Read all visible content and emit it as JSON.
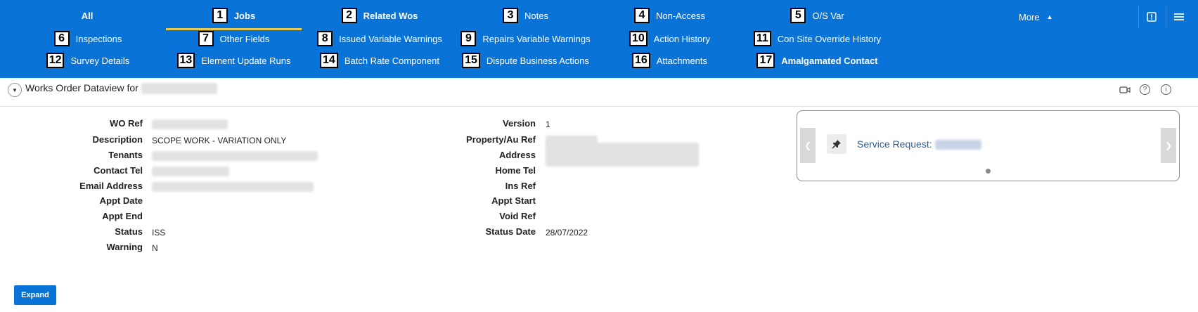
{
  "nav": {
    "tabs": [
      {
        "num": "",
        "label": "All"
      },
      {
        "num": "1",
        "label": "Jobs"
      },
      {
        "num": "2",
        "label": "Related Wos"
      },
      {
        "num": "3",
        "label": "Notes"
      },
      {
        "num": "4",
        "label": "Non-Access"
      },
      {
        "num": "5",
        "label": "O/S Var"
      },
      {
        "num": "6",
        "label": "Inspections"
      },
      {
        "num": "7",
        "label": "Other Fields"
      },
      {
        "num": "8",
        "label": "Issued Variable Warnings"
      },
      {
        "num": "9",
        "label": "Repairs Variable Warnings"
      },
      {
        "num": "10",
        "label": "Action History"
      },
      {
        "num": "11",
        "label": "Con Site Override History"
      },
      {
        "num": "12",
        "label": "Survey Details"
      },
      {
        "num": "13",
        "label": "Element Update Runs"
      },
      {
        "num": "14",
        "label": "Batch Rate Component"
      },
      {
        "num": "15",
        "label": "Dispute Business Actions"
      },
      {
        "num": "16",
        "label": "Attachments"
      },
      {
        "num": "17",
        "label": "Amalgamated Contact"
      }
    ],
    "more_label": "More"
  },
  "region": {
    "title": "Works Order Dataview for"
  },
  "fields_left": [
    {
      "label": "WO Ref",
      "value": ""
    },
    {
      "label": "Description",
      "value": "SCOPE WORK - VARIATION ONLY"
    },
    {
      "label": "Tenants",
      "value": ""
    },
    {
      "label": "Contact Tel",
      "value": ""
    },
    {
      "label": "Email Address",
      "value": ""
    },
    {
      "label": "Appt Date",
      "value": ""
    },
    {
      "label": "Appt End",
      "value": ""
    },
    {
      "label": "Status",
      "value": "ISS"
    },
    {
      "label": "Warning",
      "value": "N"
    }
  ],
  "fields_right": [
    {
      "label": "Version",
      "value": "1"
    },
    {
      "label": "Property/Au Ref",
      "value": ""
    },
    {
      "label": "Address",
      "value": ""
    },
    {
      "label": "Home Tel",
      "value": ""
    },
    {
      "label": "Ins Ref",
      "value": ""
    },
    {
      "label": "Appt Start",
      "value": ""
    },
    {
      "label": "Void Ref",
      "value": ""
    },
    {
      "label": "Status Date",
      "value": "28/07/2022"
    }
  ],
  "carousel": {
    "label": "Service Request:"
  },
  "expand_label": "Expand"
}
